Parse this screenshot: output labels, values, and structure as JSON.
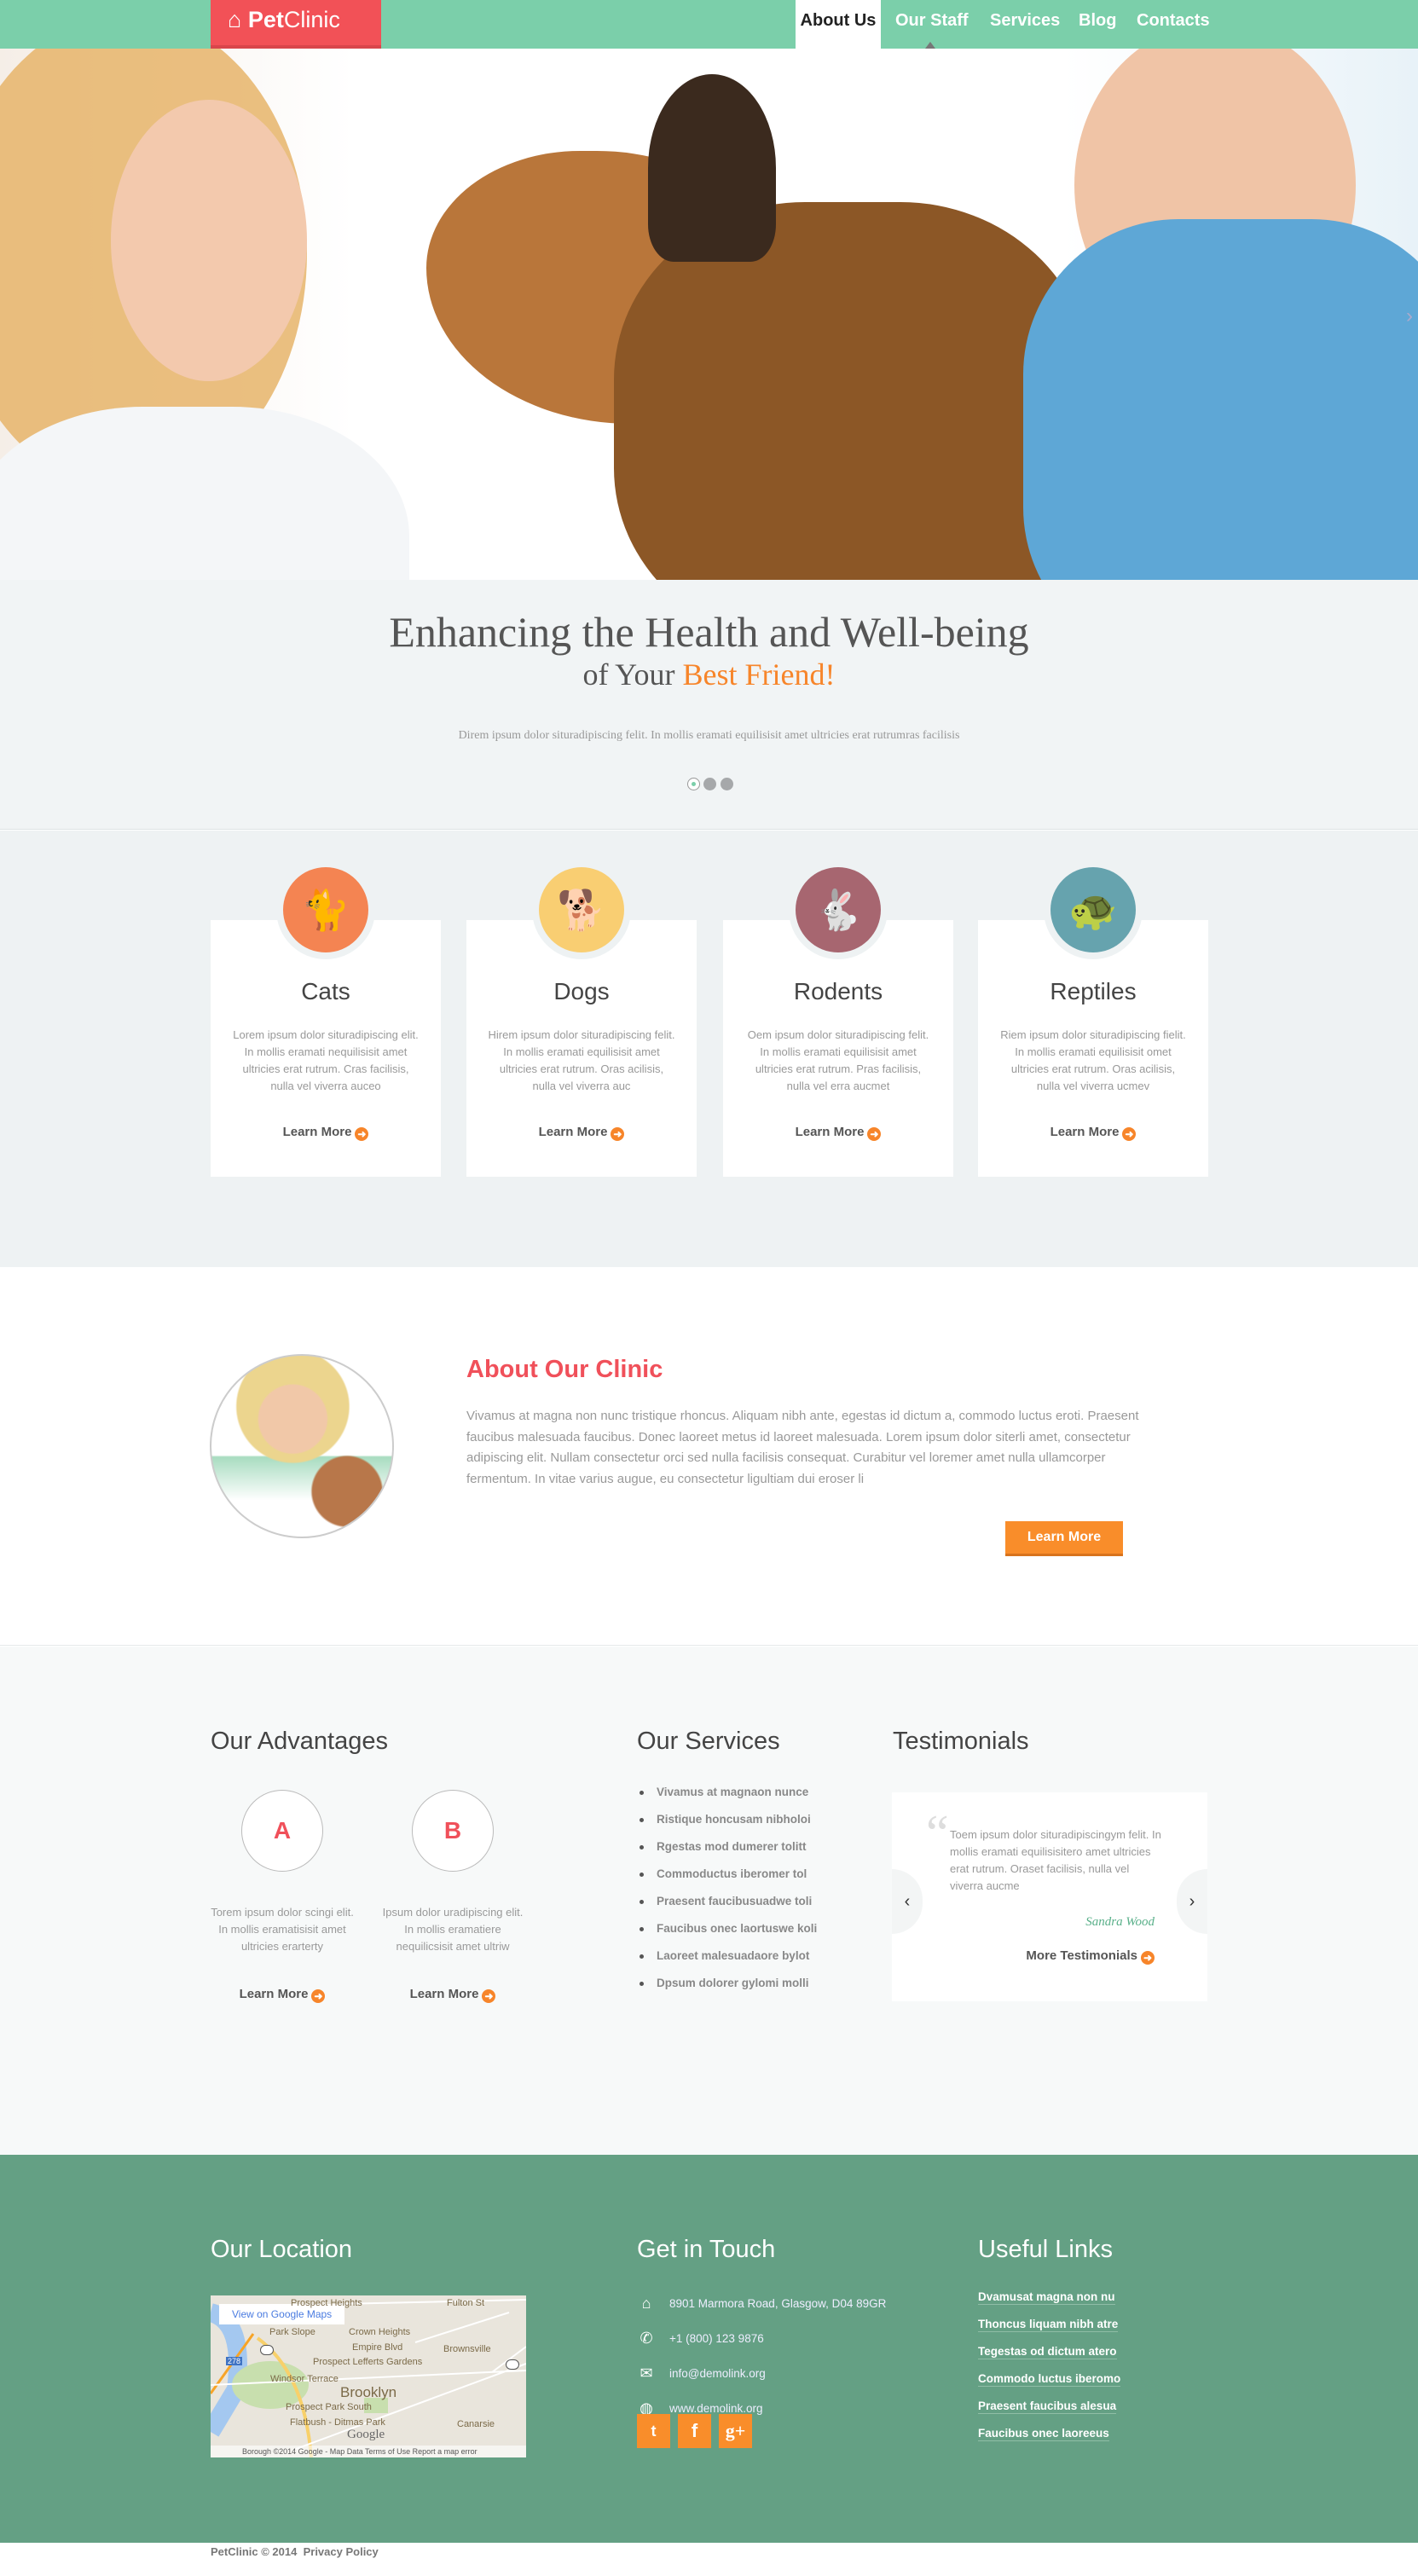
{
  "brand": {
    "logo_pet": "Pet",
    "logo_clinic": "Clinic"
  },
  "nav": {
    "items": [
      {
        "label": "About Us",
        "active": true
      },
      {
        "label": "Our Staff"
      },
      {
        "label": "Services"
      },
      {
        "label": "Blog"
      },
      {
        "label": "Contacts"
      }
    ]
  },
  "colors": {
    "nav": "#7bcfaa",
    "logo": "#f25157",
    "accent": "#f7852a",
    "title_red": "#f0505a",
    "footer": "#64a084"
  },
  "slogan": {
    "line1": "Enhancing the Health and Well-being",
    "line2_prefix": "of Your",
    "line2_highlight": "Best Friend!",
    "text": "Direm ipsum dolor situradipiscing felit. In mollis eramati equilisisit amet ultricies erat rutrumras facilisis",
    "slides": 3,
    "active_slide": 1
  },
  "cards": [
    {
      "title": "Cats",
      "icon": "cat-icon",
      "color": "#f48452",
      "text": "Lorem ipsum dolor situradipiscing elit. In mollis eramati nequilisisit amet ultricies erat rutrum. Cras facilisis, nulla vel viverra auceo",
      "link": "Learn More"
    },
    {
      "title": "Dogs",
      "icon": "dog-icon",
      "color": "#f9ce72",
      "text": "Hirem ipsum dolor situradipiscing felit. In mollis eramati equilisisit amet ultricies erat rutrum. Oras acilisis, nulla vel viverra auc",
      "link": "Learn More"
    },
    {
      "title": "Rodents",
      "icon": "rabbit-icon",
      "color": "#a76670",
      "text": "Oem ipsum dolor situradipiscing felit. In mollis eramati equilisisit amet ultricies erat rutrum. Pras facilisis, nulla vel erra aucmet",
      "link": "Learn More"
    },
    {
      "title": "Reptiles",
      "icon": "turtle-icon",
      "color": "#66a3ae",
      "text": "Riem ipsum dolor situradipiscing fielit. In mollis eramati equilisisit omet ultricies erat rutrum. Oras acilisis, nulla vel viverra ucmev",
      "link": "Learn More"
    }
  ],
  "about": {
    "title": "About Our Clinic",
    "text": "Vivamus at magna non nunc tristique rhoncus. Aliquam nibh ante, egestas id dictum a, commodo luctus eroti. Praesent faucibus malesuada faucibus. Donec laoreet metus id laoreet malesuada. Lorem ipsum dolor siterli amet, consectetur adipiscing elit. Nullam consectetur orci sed nulla facilisis consequat. Curabitur vel loremer amet nulla ullamcorper fermentum. In vitae varius augue, eu consectetur ligultiam dui eroser li",
    "button": "Learn More"
  },
  "advantages": {
    "title": "Our Advantages",
    "items": [
      {
        "letter": "A",
        "text": "Torem ipsum dolor scingi elit. In mollis eramatisisit amet ultricies erarterty",
        "link": "Learn More"
      },
      {
        "letter": "B",
        "text": "Ipsum dolor uradipiscing elit. In mollis eramatiere nequilicsisit amet ultriw",
        "link": "Learn More"
      }
    ]
  },
  "services": {
    "title": "Our Services",
    "items": [
      "Vivamus at magnaon nunce",
      "Ristique honcusam nibholoi",
      "Rgestas mod dumerer tolitt",
      "Commoductus iberomer tol",
      "Praesent faucibusuadwe toli",
      "Faucibus onec laortuswe koli",
      "Laoreet malesuadaore bylot",
      "Dpsum dolorer gylomi molli"
    ]
  },
  "testimonials": {
    "title": "Testimonials",
    "text": "Toem ipsum dolor situradipiscingym felit. In mollis eramati equilisisitero amet ultricies erat rutrum. Oraset facilisis, nulla vel viverra aucme",
    "author": "Sandra Wood",
    "more": "More Testimonials"
  },
  "footer": {
    "location": {
      "title": "Our Location",
      "map_button": "View on Google Maps",
      "map_labels": [
        "Park Slope",
        "Crown Heights",
        "Empire Blvd",
        "Brownsville",
        "Prospect Lefferts Gardens",
        "Windsor Terrace",
        "Brooklyn",
        "Prospect Park South",
        "Flatbush - Ditmas Park",
        "Canarsie",
        "Fulton St",
        "Prospect Heights",
        "278",
        "27",
        "27",
        "Google"
      ],
      "map_footer": "Borough ©2014 Google - Map Data   Terms of Use   Report a map error"
    },
    "contact": {
      "title": "Get in Touch",
      "address": "8901 Marmora Road, Glasgow, D04 89GR",
      "phone": "+1 (800) 123 9876",
      "email": "info@demolink.org",
      "web": "www.demolink.org",
      "social": [
        "twitter",
        "facebook",
        "google-plus"
      ],
      "social_glyphs": [
        "🐦",
        "f",
        "g+"
      ]
    },
    "links": {
      "title": "Useful Links",
      "items": [
        "Dvamusat magna non nu",
        "Thoncus liquam nibh atre",
        "Tegestas od dictum atero",
        "Commodo luctus iberomo",
        "Praesent faucibus alesua",
        "Faucibus onec laoreeus"
      ]
    }
  },
  "copyright": {
    "text": "PetClinic © 2014",
    "link": "Privacy Policy"
  }
}
